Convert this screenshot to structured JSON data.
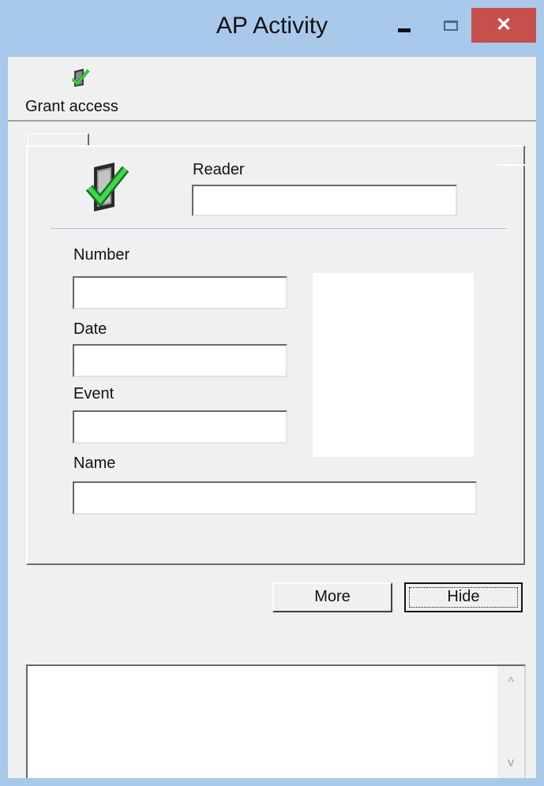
{
  "window": {
    "title": "AP Activity"
  },
  "titlebar_controls": {
    "close_glyph": "✕"
  },
  "toolbar": {
    "grant_access_label": "Grant access",
    "grant_access_icon": "door-checkmark-icon"
  },
  "form": {
    "reader_label": "Reader",
    "reader_value": "",
    "number_label": "Number",
    "number_value": "",
    "date_label": "Date",
    "date_value": "",
    "event_label": "Event",
    "event_value": "",
    "name_label": "Name",
    "name_value": ""
  },
  "buttons": {
    "more_label": "More",
    "hide_label": "Hide"
  },
  "log": {
    "text": "",
    "scroll_up_glyph": "^",
    "scroll_down_glyph": "v"
  },
  "colors": {
    "titlebar": "#a8c9ea",
    "close_button": "#c7504c",
    "face": "#f0f0f0",
    "check_green": "#2fc23a"
  }
}
